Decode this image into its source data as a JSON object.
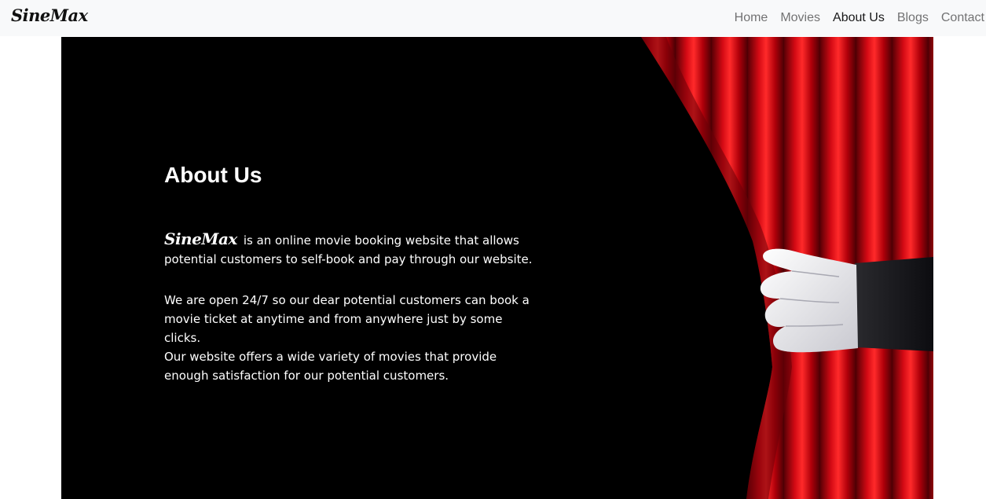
{
  "navbar": {
    "brand": "SineMax",
    "links": [
      {
        "label": "Home",
        "active": false
      },
      {
        "label": "Movies",
        "active": false
      },
      {
        "label": "About Us",
        "active": true
      },
      {
        "label": "Blogs",
        "active": false
      },
      {
        "label": "Contact",
        "active": false
      }
    ]
  },
  "about": {
    "title": "About Us",
    "brand_inline": "SineMax",
    "paragraph1": "is an online movie booking website that allows potential customers to self-book and pay through our website.",
    "paragraph2": "We are open 24/7 so our dear potential customers can book a movie ticket at anytime and from anywhere just by some clicks.",
    "paragraph3": "Our website offers a wide variety of movies that provide enough satisfaction for our potential customers."
  },
  "colors": {
    "navbar_bg": "#f8f9fa",
    "hero_bg": "#000000",
    "curtain": "#c4000c",
    "text": "#ffffff"
  },
  "icons": [
    "curtain-image",
    "white-glove-hand-image"
  ]
}
